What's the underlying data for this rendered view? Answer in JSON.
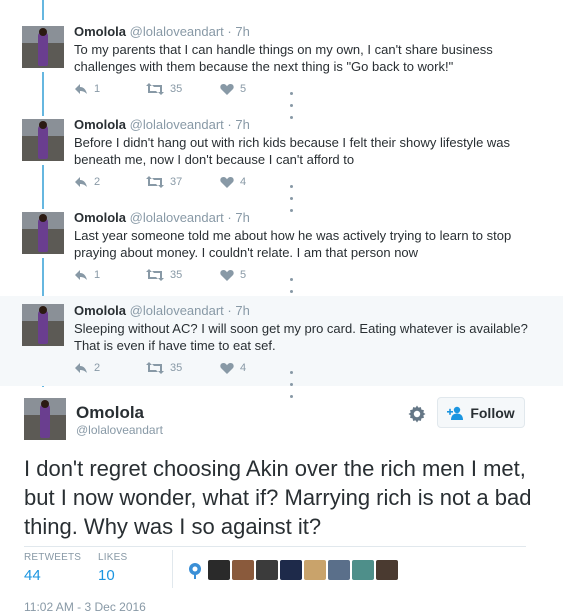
{
  "thread": [
    {
      "name": "Omolola",
      "handle": "@lolaloveandart",
      "time": "7h",
      "text": "To my parents that I can handle things on my own, I can't share business challenges with them because the next thing is \"Go back to work!\"",
      "replies": "1",
      "retweets": "35",
      "likes": "5"
    },
    {
      "name": "Omolola",
      "handle": "@lolaloveandart",
      "time": "7h",
      "text": "Before I didn't hang out with rich kids because I felt their showy lifestyle was beneath me, now I don't because I can't afford to",
      "replies": "2",
      "retweets": "37",
      "likes": "4"
    },
    {
      "name": "Omolola",
      "handle": "@lolaloveandart",
      "time": "7h",
      "text": "Last year someone told me about how he was actively trying to learn to stop praying about money. I couldn't relate. I am that person now",
      "replies": "1",
      "retweets": "35",
      "likes": "5"
    },
    {
      "name": "Omolola",
      "handle": "@lolaloveandart",
      "time": "7h",
      "text": "Sleeping without AC? I will soon get my pro card. Eating whatever is available? That is even if have time to eat sef.",
      "replies": "2",
      "retweets": "35",
      "likes": "4"
    }
  ],
  "main": {
    "name": "Omolola",
    "handle": "@lolaloveandart",
    "follow_label": "Follow",
    "text": "I don't regret choosing Akin over the rich men I met, but I now wonder, what if? Marrying rich is not a bad thing. Why was I so against it?",
    "retweets_label": "RETWEETS",
    "retweets": "44",
    "likes_label": "LIKES",
    "likes": "10",
    "footer": "11:02 AM - 3 Dec 2016"
  },
  "colors": {
    "thread_line": "#66b7e0",
    "link_blue": "#1b95e0",
    "muted": "#8899a6",
    "highlight_bg": "#f5f8fa"
  },
  "icons": [
    "reply-icon",
    "retweet-icon",
    "heart-icon",
    "more-icon",
    "gear-icon",
    "follow-icon"
  ]
}
